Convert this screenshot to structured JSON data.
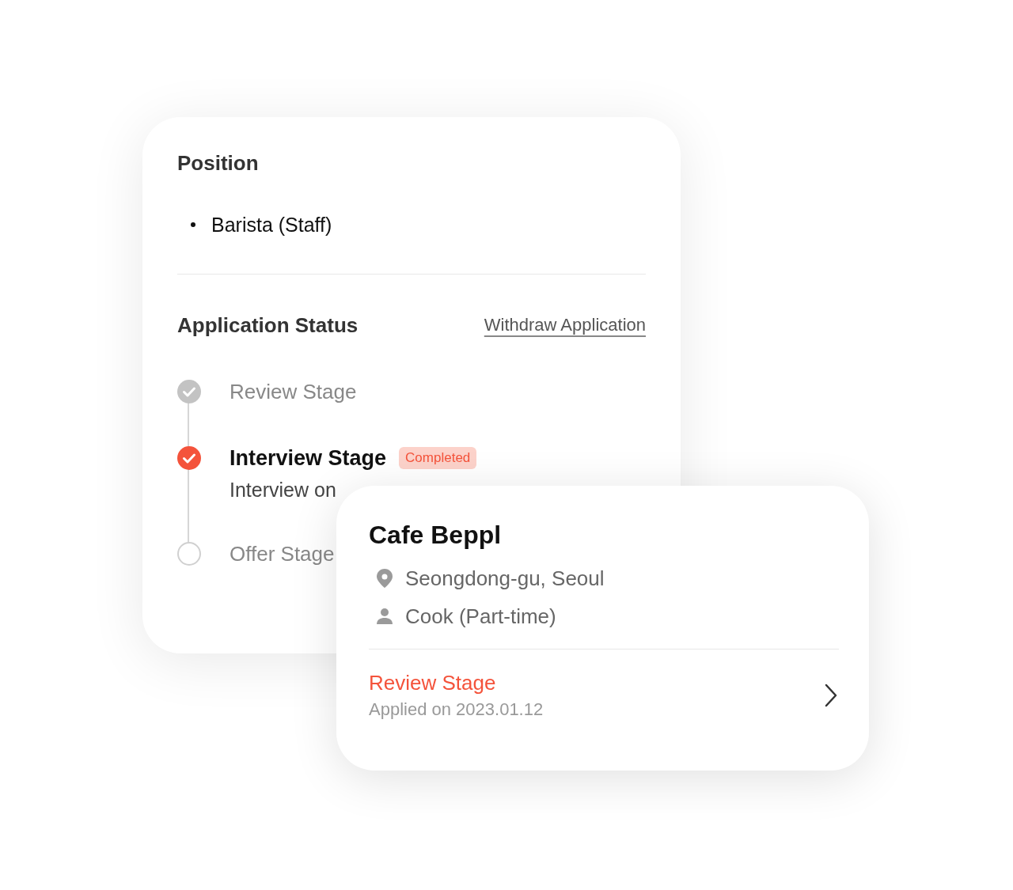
{
  "position": {
    "title": "Position",
    "items": [
      "Barista (Staff)"
    ]
  },
  "status": {
    "title": "Application Status",
    "withdraw_link": "Withdraw Application",
    "steps": [
      {
        "kind": "done",
        "label": "Review Stage"
      },
      {
        "kind": "current",
        "label": "Interview Stage",
        "badge": "Completed",
        "detail": "Interview on"
      },
      {
        "kind": "pending",
        "label": "Offer Stage"
      }
    ]
  },
  "job_card": {
    "name": "Cafe Beppl",
    "details": [
      {
        "kind": "location",
        "text": "Seongdong-gu, Seoul"
      },
      {
        "kind": "role",
        "text": "Cook (Part-time)"
      }
    ],
    "stage": "Review Stage",
    "applied": "Applied on 2023.01.12"
  }
}
